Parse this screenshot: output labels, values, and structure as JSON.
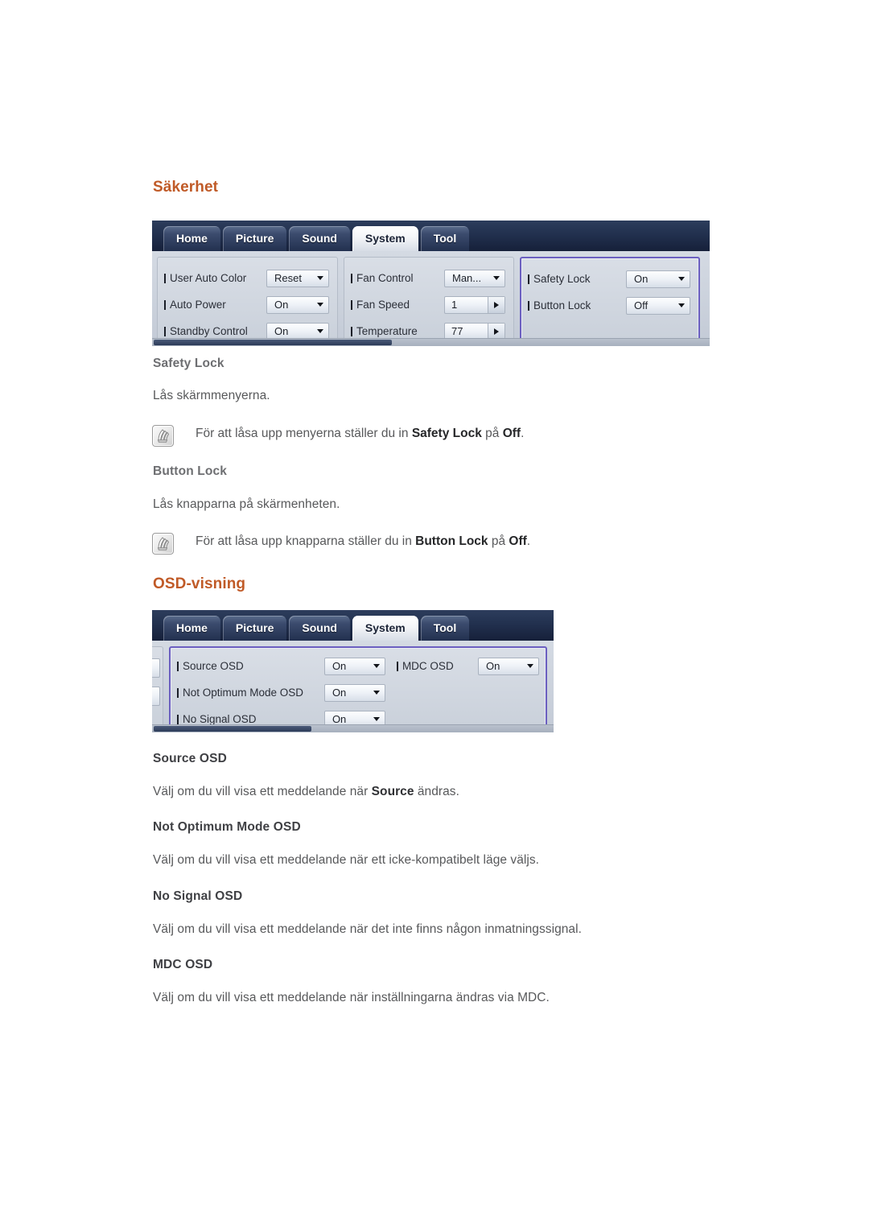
{
  "sections": {
    "safety": {
      "heading": "Säkerhet",
      "osd": {
        "tabs": [
          {
            "label": "Home",
            "active": false
          },
          {
            "label": "Picture",
            "active": false
          },
          {
            "label": "Sound",
            "active": false
          },
          {
            "label": "System",
            "active": true
          },
          {
            "label": "Tool",
            "active": false
          }
        ],
        "col1": [
          {
            "label": "User Auto Color",
            "value": "Reset",
            "type": "select"
          },
          {
            "label": "Auto Power",
            "value": "On",
            "type": "select"
          },
          {
            "label": "Standby Control",
            "value": "On",
            "type": "select"
          }
        ],
        "col2": [
          {
            "label": "Fan Control",
            "value": "Man...",
            "type": "select"
          },
          {
            "label": "Fan Speed",
            "value": "1",
            "type": "spinner"
          },
          {
            "label": "Temperature",
            "value": "77",
            "type": "spinner"
          }
        ],
        "col3": [
          {
            "label": "Safety Lock",
            "value": "On",
            "type": "select"
          },
          {
            "label": "Button Lock",
            "value": "Off",
            "type": "select"
          }
        ]
      },
      "items": [
        {
          "title": "Safety Lock",
          "body": "Lås skärmmenyerna.",
          "note": {
            "pre": "För att låsa upp menyerna ställer du in ",
            "b1": "Safety Lock",
            "mid": " på ",
            "b2": "Off",
            "post": "."
          }
        },
        {
          "title": "Button Lock",
          "body": "Lås knapparna på skärmenheten.",
          "note": {
            "pre": "För att låsa upp knapparna ställer du in ",
            "b1": "Button Lock",
            "mid": " på ",
            "b2": "Off",
            "post": "."
          }
        }
      ]
    },
    "osdvisning": {
      "heading": "OSD-visning",
      "osd": {
        "tabs": [
          {
            "label": "Home",
            "active": false
          },
          {
            "label": "Picture",
            "active": false
          },
          {
            "label": "Sound",
            "active": false
          },
          {
            "label": "System",
            "active": true
          },
          {
            "label": "Tool",
            "active": false
          }
        ],
        "col1": [
          {
            "label": "Source OSD",
            "value": "On",
            "type": "select"
          },
          {
            "label": "Not Optimum Mode OSD",
            "value": "On",
            "type": "select"
          },
          {
            "label": "No Signal OSD",
            "value": "On",
            "type": "select"
          }
        ],
        "col2": [
          {
            "label": "MDC OSD",
            "value": "On",
            "type": "select"
          }
        ]
      },
      "items": [
        {
          "title": "Source OSD",
          "pre": "Välj om du vill visa ett meddelande när ",
          "b": "Source",
          "post": " ändras."
        },
        {
          "title": "Not Optimum Mode OSD",
          "pre": "Välj om du vill visa ett meddelande när ett icke-kompatibelt läge väljs.",
          "b": "",
          "post": ""
        },
        {
          "title": "No Signal OSD",
          "pre": "Välj om du vill visa ett meddelande när det inte finns någon inmatningssignal.",
          "b": "",
          "post": ""
        },
        {
          "title": "MDC OSD",
          "pre": "Välj om du vill visa ett meddelande när inställningarna ändras via MDC.",
          "b": "",
          "post": ""
        }
      ]
    }
  },
  "colors": {
    "heading": "#c05a27",
    "subheading": "#6d6e71",
    "body": "#58595b",
    "osd_focus_border": "#6b5fc0",
    "osd_tabbar": "#22304f"
  },
  "icons": {
    "note": "note-pen-icon"
  }
}
